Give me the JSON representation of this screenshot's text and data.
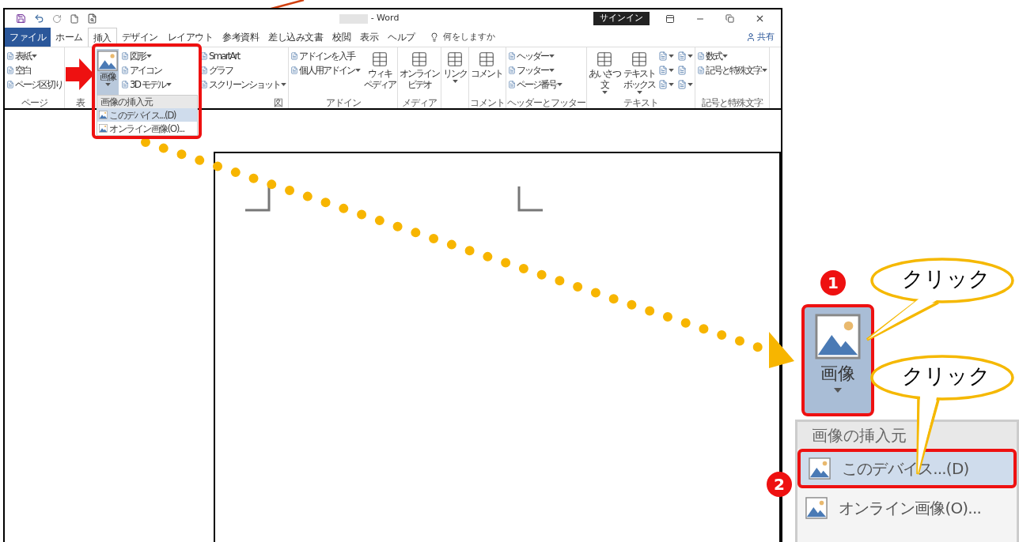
{
  "title_bar": {
    "title": "- Word",
    "sign_in": "サインイン"
  },
  "tabs": [
    {
      "label": "ファイル",
      "kind": "file",
      "selected": false
    },
    {
      "label": "ホーム",
      "kind": "tab",
      "selected": false
    },
    {
      "label": "挿入",
      "kind": "tab",
      "selected": true
    },
    {
      "label": "デザイン",
      "kind": "tab",
      "selected": false
    },
    {
      "label": "レイアウト",
      "kind": "tab",
      "selected": false
    },
    {
      "label": "参考資料",
      "kind": "tab",
      "selected": false
    },
    {
      "label": "差し込み文書",
      "kind": "tab",
      "selected": false
    },
    {
      "label": "校閲",
      "kind": "tab",
      "selected": false
    },
    {
      "label": "表示",
      "kind": "tab",
      "selected": false
    },
    {
      "label": "ヘルプ",
      "kind": "tab",
      "selected": false
    }
  ],
  "tell_me": "何をしますか",
  "share": "共有",
  "ribbon": [
    {
      "label": "ページ",
      "columns": [
        [
          {
            "kind": "small",
            "label": "表紙",
            "caret": true
          },
          {
            "kind": "small",
            "label": "空白",
            "caret": false
          },
          {
            "kind": "small",
            "label": "ページ区切り",
            "caret": false
          }
        ]
      ]
    },
    {
      "label": "表"
    },
    {
      "label": "図",
      "columns": [
        [
          {
            "kind": "large",
            "lines": [
              "画像"
            ],
            "caret": true,
            "selected": true
          }
        ],
        [
          {
            "kind": "small",
            "label": "図形",
            "caret": true
          },
          {
            "kind": "small",
            "label": "アイコン",
            "caret": false
          },
          {
            "kind": "small",
            "label": "3D モデル",
            "caret": true
          }
        ],
        [
          {
            "kind": "small",
            "label": "SmartArt",
            "caret": false
          },
          {
            "kind": "small",
            "label": "グラフ",
            "caret": false
          },
          {
            "kind": "small",
            "label": "スクリーンショット",
            "caret": true
          }
        ]
      ]
    },
    {
      "label": "アドイン",
      "columns": [
        [
          {
            "kind": "small",
            "label": "アドインを入手",
            "caret": false
          },
          {
            "kind": "small",
            "label": "個人用アドイン",
            "caret": true
          }
        ],
        [
          {
            "kind": "large",
            "lines": [
              "ウィキ",
              "ペディア"
            ],
            "caret": false,
            "selected": false
          }
        ]
      ]
    },
    {
      "label": "メディア",
      "columns": [
        [
          {
            "kind": "large",
            "lines": [
              "オンライン",
              "ビデオ"
            ],
            "caret": false,
            "selected": false
          }
        ]
      ]
    },
    {
      "columns": [
        [
          {
            "kind": "large",
            "lines": [
              "リンク"
            ],
            "caret": true,
            "selected": false
          }
        ]
      ]
    },
    {
      "label": "コメント",
      "columns": [
        [
          {
            "kind": "large",
            "lines": [
              "コメント"
            ],
            "caret": false,
            "selected": false
          }
        ]
      ]
    },
    {
      "label": "ヘッダーとフッター",
      "columns": [
        [
          {
            "kind": "small",
            "label": "ヘッダー",
            "caret": true
          },
          {
            "kind": "small",
            "label": "フッター",
            "caret": true
          },
          {
            "kind": "small",
            "label": "ページ番号",
            "caret": true
          }
        ]
      ]
    },
    {
      "label": "テキスト",
      "columns": [
        [
          {
            "kind": "large",
            "lines": [
              "あいさつ",
              "文"
            ],
            "caret": true,
            "selected": false
          }
        ],
        [
          {
            "kind": "large",
            "lines": [
              "テキスト",
              "ボックス"
            ],
            "caret": true,
            "selected": false
          }
        ],
        [
          {
            "kind": "icon",
            "caret": true
          },
          {
            "kind": "icon",
            "caret": true
          },
          {
            "kind": "icon",
            "caret": true
          }
        ],
        [
          {
            "kind": "icon",
            "caret": true
          },
          {
            "kind": "icon",
            "caret": false
          },
          {
            "kind": "icon",
            "caret": true
          }
        ]
      ]
    },
    {
      "label": "記号と特殊文字",
      "columns": [
        [
          {
            "kind": "small",
            "label": "数式",
            "caret": true
          },
          {
            "kind": "small",
            "label": "記号と特殊文字",
            "caret": true
          }
        ]
      ]
    }
  ],
  "picture_menu": {
    "header": "画像の挿入元",
    "items": [
      {
        "label": "このデバイス...(D)",
        "selected": true
      },
      {
        "label": "オンライン画像(O)...",
        "selected": false
      }
    ]
  },
  "callout": {
    "button": "画像",
    "header": "画像の挿入元",
    "items": [
      {
        "label": "このデバイス...(D)",
        "selected": true
      },
      {
        "label": "オンライン画像(O)...",
        "selected": false
      }
    ],
    "steps": [
      {
        "number": "1",
        "bubble": "クリック"
      },
      {
        "number": "2",
        "bubble": "クリック"
      }
    ]
  }
}
